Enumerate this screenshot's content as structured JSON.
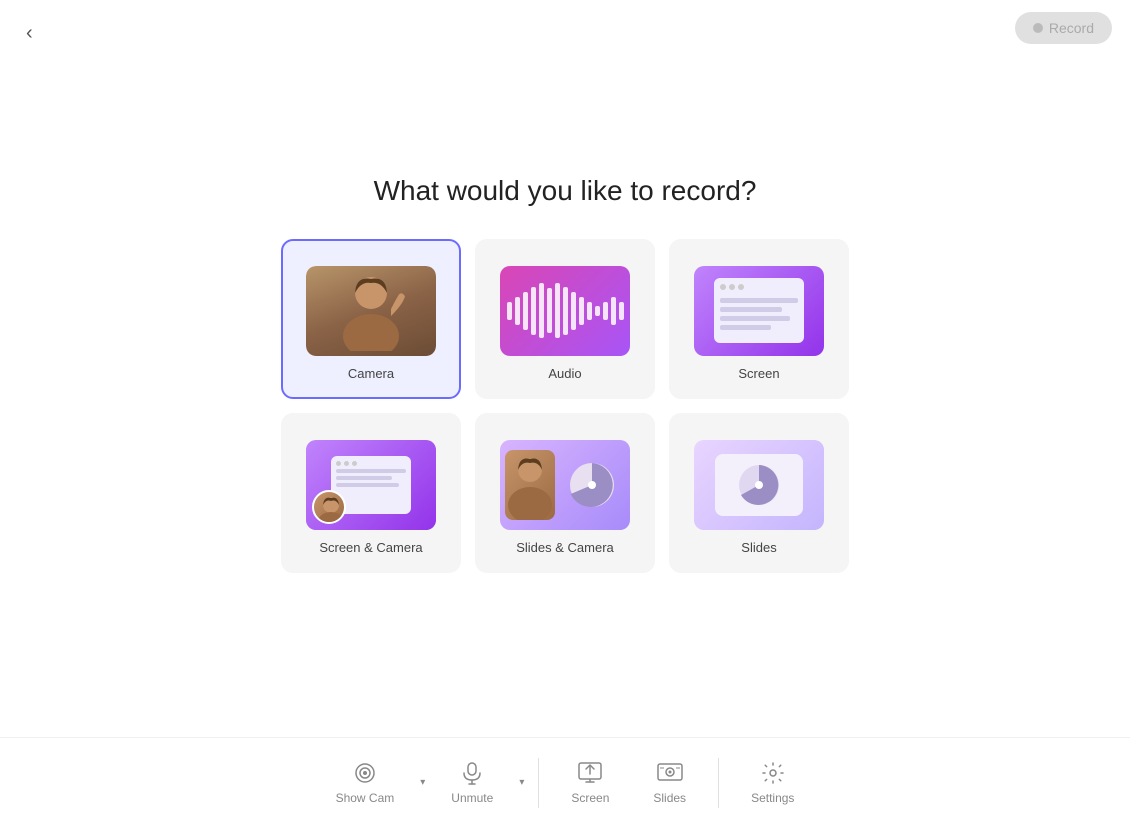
{
  "header": {
    "back_label": "‹",
    "record_label": "Record"
  },
  "main": {
    "title": "What would you like to record?",
    "cards": [
      {
        "id": "camera",
        "label": "Camera",
        "selected": true
      },
      {
        "id": "audio",
        "label": "Audio",
        "selected": false
      },
      {
        "id": "screen",
        "label": "Screen",
        "selected": false
      },
      {
        "id": "screen-camera",
        "label": "Screen & Camera",
        "selected": false
      },
      {
        "id": "slides-camera",
        "label": "Slides & Camera",
        "selected": false
      },
      {
        "id": "slides",
        "label": "Slides",
        "selected": false
      }
    ]
  },
  "bottom_bar": {
    "show_cam_label": "Show Cam",
    "unmute_label": "Unmute",
    "screen_label": "Screen",
    "slides_label": "Slides",
    "settings_label": "Settings"
  }
}
